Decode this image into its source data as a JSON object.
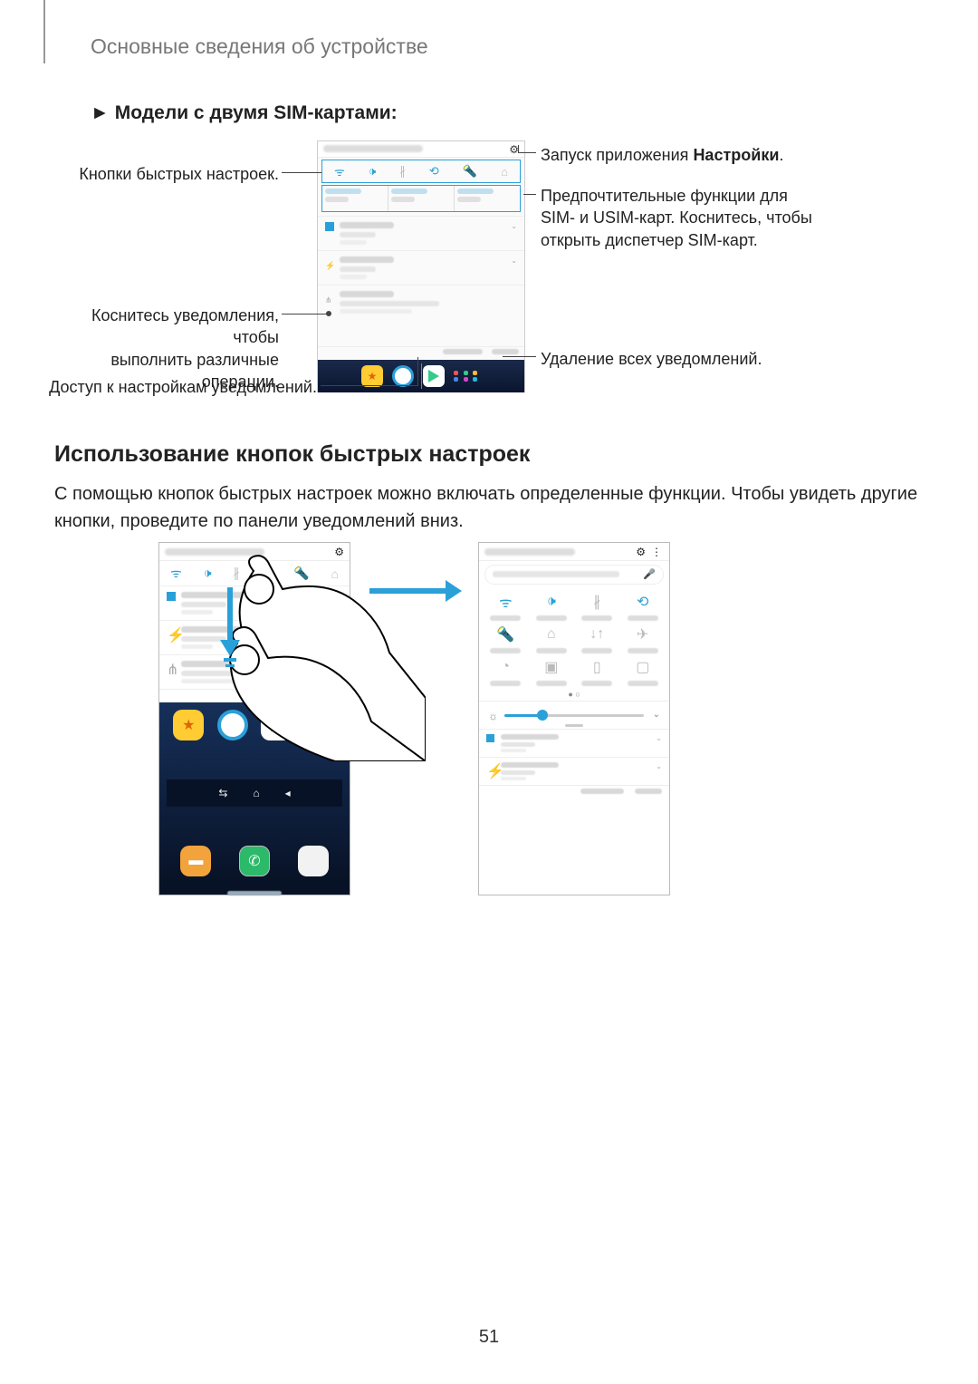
{
  "breadcrumb": "Основные сведения об устройстве",
  "subheading_prefix": "►",
  "subheading": "Модели с двумя SIM-картами",
  "subheading_suffix": ":",
  "callouts": {
    "quick_buttons": "Кнопки быстрых настроек.",
    "tap_notif_l1": "Коснитесь уведомления, чтобы",
    "tap_notif_l2": "выполнить различные операции.",
    "notif_settings": "Доступ к настройкам уведомлений.",
    "launch_settings_pre": "Запуск приложения ",
    "launch_settings_bold": "Настройки",
    "launch_settings_post": ".",
    "sim_l1": "Предпочтительные функции для",
    "sim_l2": "SIM- и USIM-карт. Коснитесь, чтобы",
    "sim_l3": "открыть диспетчер SIM-карт.",
    "clear_all": "Удаление всех уведомлений."
  },
  "section_heading": "Использование кнопок быстрых настроек",
  "body": "С помощью кнопок быстрых настроек можно включать определенные функции. Чтобы увидеть другие кнопки, проведите по панели уведомлений вниз.",
  "page_number": "51"
}
